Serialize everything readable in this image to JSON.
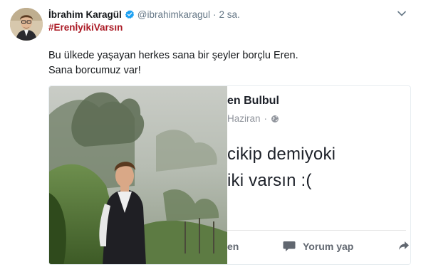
{
  "tweet": {
    "author_name": "İbrahim Karagül",
    "handle": "@ibrahimkaragul",
    "separator": "·",
    "time": "2 sa.",
    "hashtag": "#ErenİyikiVarsın",
    "text_line1": "Bu ülkede yaşayan herkes sana bir şeyler borçlu Eren.",
    "text_line2": "Sana borcumuz var!"
  },
  "icons": {
    "verified": "verified-badge-icon",
    "more": "chevron-down-icon",
    "globe": "globe-icon",
    "comment": "comment-icon",
    "share": "share-icon"
  },
  "media": {
    "fb_post": {
      "name_fragment": "en Bulbul",
      "date_fragment": "Haziran",
      "separator": "·",
      "line1": "cikip demiyoki",
      "line2": "iki varsın :(",
      "like_fragment": "en",
      "comment_label": "Yorum yap"
    }
  },
  "colors": {
    "hashtag": "#ab1a25",
    "verified": "#1da1f2",
    "secondary_text": "#657786",
    "fb_gray": "#90949c"
  }
}
